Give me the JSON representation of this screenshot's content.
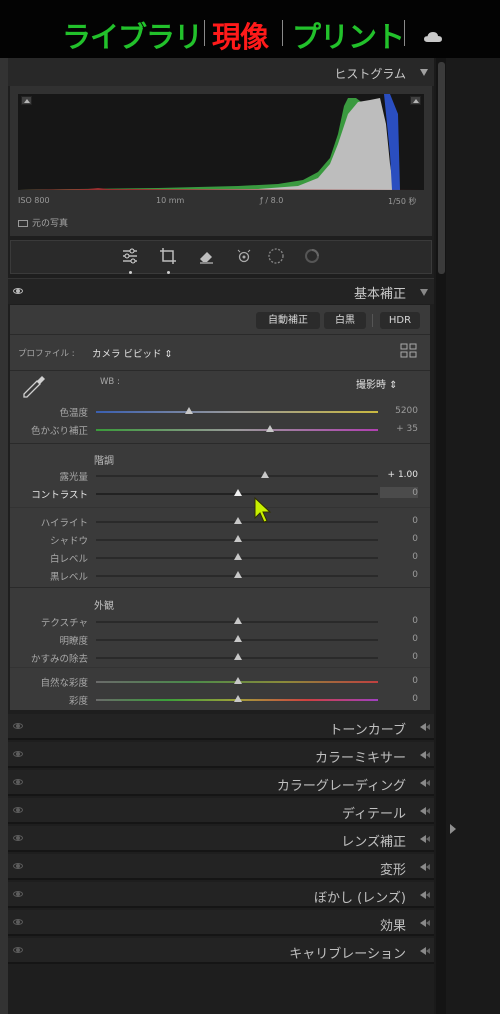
{
  "modules": {
    "library": "ライブラリ",
    "develop": "現像",
    "print": "プリント",
    "colors": {
      "inactive": "#22c12b",
      "active": "#ff1a1a"
    },
    "cloud_icon": "cloud-icon"
  },
  "histogram": {
    "title": "ヒストグラム",
    "iso": "ISO 800",
    "focal": "10 mm",
    "aperture": "ƒ / 8.0",
    "shutter": "1/50 秒",
    "original_photo": "元の写真"
  },
  "tools": [
    "sliders-icon",
    "crop-icon",
    "eraser-icon",
    "redeye-icon",
    "mask-icon",
    "preset-icon"
  ],
  "basic": {
    "title": "基本補正",
    "auto": "自動補正",
    "bw": "白黒",
    "hdr": "HDR",
    "profile_label": "プロファイル :",
    "profile_value": "カメラ ビビッド",
    "wb_label": "WB :",
    "wb_value": "撮影時",
    "temp_label": "色温度",
    "temp_value": "5200",
    "tint_label": "色かぶり補正",
    "tint_value": "+ 35",
    "tone_title": "階調",
    "exposure_label": "露光量",
    "exposure_value": "+ 1.00",
    "contrast_label": "コントラスト",
    "contrast_value": "0",
    "highlights_label": "ハイライト",
    "highlights_value": "0",
    "shadows_label": "シャドウ",
    "shadows_value": "0",
    "whites_label": "白レベル",
    "whites_value": "0",
    "blacks_label": "黒レベル",
    "blacks_value": "0",
    "presence_title": "外観",
    "texture_label": "テクスチャ",
    "texture_value": "0",
    "clarity_label": "明瞭度",
    "clarity_value": "0",
    "dehaze_label": "かすみの除去",
    "dehaze_value": "0",
    "vibrance_label": "自然な彩度",
    "vibrance_value": "0",
    "saturation_label": "彩度",
    "saturation_value": "0"
  },
  "sections": {
    "tone_curve": "トーンカーブ",
    "color_mixer": "カラーミキサー",
    "color_grading": "カラーグレーディング",
    "detail": "ディテール",
    "lens": "レンズ補正",
    "transform": "変形",
    "effects_blur": "ぼかし (レンズ)",
    "effects": "効果",
    "calibration": "キャリブレーション"
  }
}
